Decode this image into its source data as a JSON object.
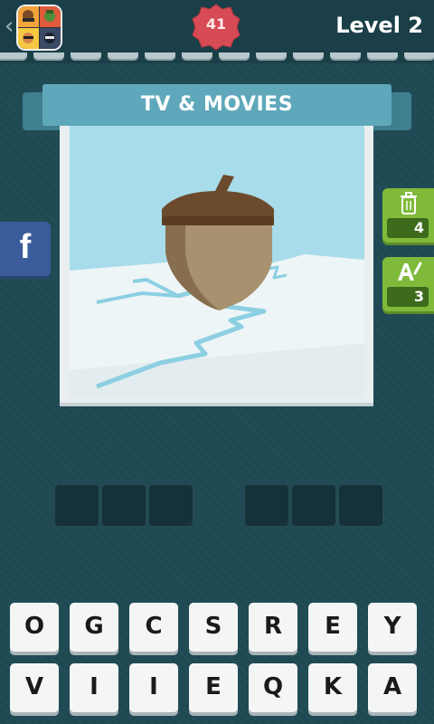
{
  "header": {
    "back_icon": "chevron-left-icon",
    "app_logo_icon": "app-logo-icon",
    "level_badge_value": "41",
    "level_title": "Level 2"
  },
  "colors": {
    "background": "#1f4a53",
    "banner": "#5fa8bb",
    "badge_red": "#d64b55",
    "hint_green": "#7fba3a",
    "facebook_blue": "#3a5c9a"
  },
  "banner": {
    "category": "TV & MOVIES"
  },
  "puzzle": {
    "image_icon": "acorn-on-ice-icon"
  },
  "side_buttons": {
    "facebook": {
      "label": "f",
      "icon": "facebook-icon"
    },
    "hints": [
      {
        "icon": "trash-can-icon",
        "count": "4"
      },
      {
        "icon": "reveal-letter-icon",
        "count": "3"
      }
    ]
  },
  "answer": {
    "words": [
      {
        "length": 3
      },
      {
        "length": 3
      }
    ]
  },
  "keyboard": {
    "row1": [
      "O",
      "G",
      "C",
      "S",
      "R",
      "E",
      "Y"
    ],
    "row2": [
      "V",
      "I",
      "I",
      "E",
      "Q",
      "K",
      "A"
    ]
  }
}
